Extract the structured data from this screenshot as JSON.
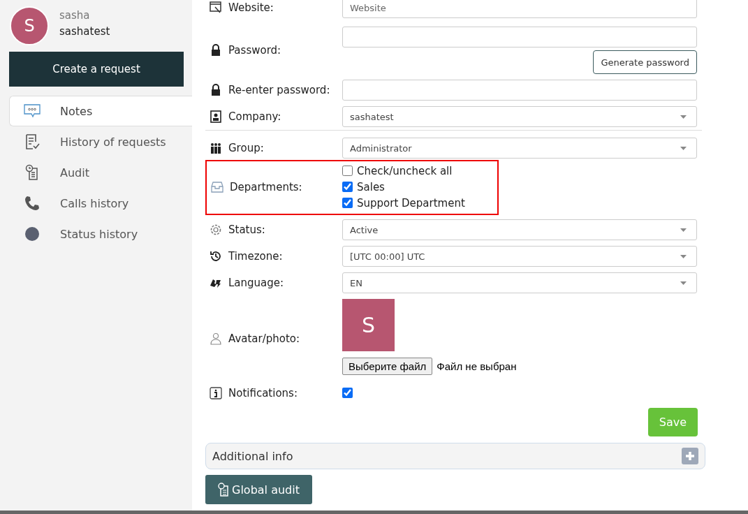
{
  "user": {
    "initial": "S",
    "name": "sasha",
    "login": "sashatest"
  },
  "create_button": "Create a request",
  "sidebar": {
    "items": [
      {
        "label": "Notes",
        "selected": true
      },
      {
        "label": "History of requests",
        "selected": false
      },
      {
        "label": "Audit",
        "selected": false
      },
      {
        "label": "Calls history",
        "selected": false
      },
      {
        "label": "Status history",
        "selected": false
      }
    ]
  },
  "form": {
    "fields": [
      {
        "kind": "text",
        "label": "Website:",
        "placeholder": "Website"
      },
      {
        "kind": "password",
        "label": "Password:",
        "button": "Generate password"
      },
      {
        "kind": "password",
        "label": "Re-enter password:"
      },
      {
        "kind": "select",
        "label": "Company:",
        "value": "sashatest",
        "divider": true
      },
      {
        "kind": "select",
        "label": "Group:",
        "value": "Administrator"
      },
      {
        "kind": "checkboxes",
        "label": "Departments:",
        "highlighted": true,
        "options": [
          {
            "label": "Check/uncheck all",
            "checked": false
          },
          {
            "label": "Sales",
            "checked": true
          },
          {
            "label": "Support Department",
            "checked": true
          }
        ]
      },
      {
        "kind": "select",
        "label": "Status:",
        "value": "Active"
      },
      {
        "kind": "select",
        "label": "Timezone:",
        "value": "[UTC 00:00] UTC"
      },
      {
        "kind": "select",
        "label": "Language:",
        "value": "EN"
      },
      {
        "kind": "avatar",
        "label": "Avatar/photo:",
        "initial": "S",
        "file_button": "Выберите файл",
        "file_status": "Файл не выбран"
      },
      {
        "kind": "checkbox",
        "label": "Notifications:",
        "checked": true
      }
    ],
    "save": "Save"
  },
  "additional_info": {
    "label": "Additional info",
    "expanded": false
  },
  "global_audit": "Global audit"
}
